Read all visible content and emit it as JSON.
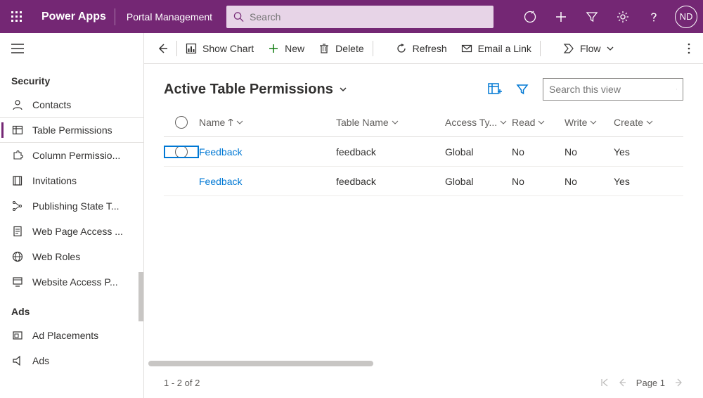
{
  "header": {
    "app_name": "Power Apps",
    "sub_name": "Portal Management",
    "search_placeholder": "Search",
    "user_initials": "ND"
  },
  "sidebar": {
    "groups": [
      {
        "label": "Security",
        "items": [
          {
            "icon": "contacts",
            "label": "Contacts"
          },
          {
            "icon": "table-perm",
            "label": "Table Permissions",
            "selected": true
          },
          {
            "icon": "column-perm",
            "label": "Column Permissio..."
          },
          {
            "icon": "invitations",
            "label": "Invitations"
          },
          {
            "icon": "publishing",
            "label": "Publishing State T..."
          },
          {
            "icon": "webpage",
            "label": "Web Page Access ..."
          },
          {
            "icon": "webroles",
            "label": "Web Roles"
          },
          {
            "icon": "website",
            "label": "Website Access P..."
          }
        ]
      },
      {
        "label": "Ads",
        "items": [
          {
            "icon": "adplace",
            "label": "Ad Placements"
          },
          {
            "icon": "ads",
            "label": "Ads"
          }
        ]
      }
    ]
  },
  "commandbar": {
    "back": "Back",
    "show_chart": "Show Chart",
    "new": "New",
    "delete": "Delete",
    "refresh": "Refresh",
    "email_link": "Email a Link",
    "flow": "Flow"
  },
  "view": {
    "title": "Active Table Permissions",
    "search_placeholder": "Search this view",
    "columns": {
      "name": "Name",
      "table_name": "Table Name",
      "access_type": "Access Ty...",
      "read": "Read",
      "write": "Write",
      "create": "Create"
    },
    "rows": [
      {
        "name": "Feedback",
        "table_name": "feedback",
        "access_type": "Global",
        "read": "No",
        "write": "No",
        "create": "Yes",
        "selected": true
      },
      {
        "name": "Feedback",
        "table_name": "feedback",
        "access_type": "Global",
        "read": "No",
        "write": "No",
        "create": "Yes"
      }
    ]
  },
  "footer": {
    "count": "1 - 2 of 2",
    "page_label": "Page 1"
  }
}
